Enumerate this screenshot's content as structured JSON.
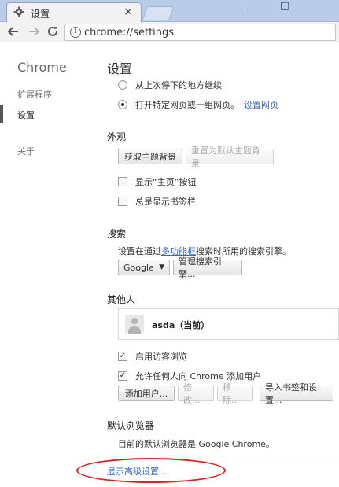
{
  "tab": {
    "title": "设置",
    "close": "×"
  },
  "window": {
    "minimize": "—",
    "maximize": "□"
  },
  "address": {
    "url": "chrome://settings"
  },
  "sidebar": {
    "brand": "Chrome",
    "items": [
      {
        "label": "扩展程序"
      },
      {
        "label": "设置"
      },
      {
        "label": "关于"
      }
    ]
  },
  "main": {
    "title": "设置",
    "startup": {
      "option_continue": "从上次停下的地方继续",
      "option_specific": "打开特定网页或一组网页。",
      "set_pages_link": "设置网页"
    },
    "appearance": {
      "title": "外观",
      "get_themes": "获取主题背景",
      "reset_theme": "重置为默认主题背景",
      "show_home": "显示“主页”按钮",
      "show_bookmarks": "总是显示书签栏"
    },
    "search": {
      "title": "搜索",
      "desc_prefix": "设置在通过",
      "desc_link": "多功能框",
      "desc_suffix": "搜索时所用的搜索引擎。",
      "engine_selected": "Google",
      "manage_engines": "管理搜索引擎..."
    },
    "people": {
      "title": "其他人",
      "user_name": "asda（当前）",
      "enable_guest": "启用访客浏览",
      "allow_add": "允许任何人向 Chrome 添加用户",
      "add_user": "添加用户...",
      "edit": "修改...",
      "remove": "移除...",
      "import": "导入书签和设置..."
    },
    "default_browser": {
      "title": "默认浏览器",
      "desc": "目前的默认浏览器是 Google Chrome。"
    },
    "show_advanced": "显示高级设置..."
  },
  "colors": {
    "link": "#3366cc",
    "annotation": "#e02020",
    "titlebar": "#b9cde9"
  }
}
